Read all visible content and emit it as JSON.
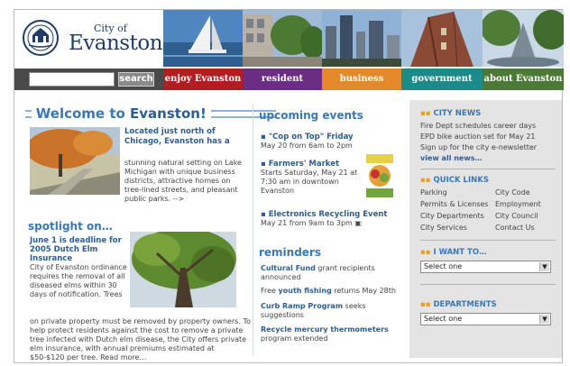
{
  "header": {
    "logo_small": "City of",
    "logo_big": "Evanston"
  },
  "search": {
    "placeholder": "",
    "button_label": "search"
  },
  "nav": [
    {
      "label": "enjoy Evanston",
      "color": "#b01e24"
    },
    {
      "label": "resident",
      "color": "#6b2d83"
    },
    {
      "label": "business",
      "color": "#e3892a"
    },
    {
      "label": "government",
      "color": "#1d8a8a"
    },
    {
      "label": "about Evanston",
      "color": "#4c7a36"
    }
  ],
  "welcome": {
    "title_prefix": "Welcome to ",
    "title_name": "Evanston!",
    "lead": "Located just north of Chicago, Evanston has a",
    "body": "stunning natural setting on Lake Michigan with unique business districts, attractive homes on tree-lined streets, and pleasant public parks. -->"
  },
  "spotlight": {
    "title": "spotlight on…",
    "headline": "June 1 is deadline for 2005 Dutch Elm Insurance",
    "body_1": "City of Evanston ordinance requires the removal of all diseased elms within 30 days of notification. Trees",
    "body_2": "on private property must be removed by property owners. To help protect residents against the cost to remove a private tree infected with Dutch elm disease, the City offers private elm insurance, with annual premiums estimated at $50-$120 per tree. Read more…"
  },
  "events": {
    "title": "upcoming events",
    "items": [
      {
        "title": "\"Cop on Top\" Friday",
        "detail": "May 20 from 6am to 2pm"
      },
      {
        "title": "Farmers' Market",
        "detail": "Starts Saturday, May 21 at 7:30 am in downtown Evanston"
      },
      {
        "title": "Electronics Recycling Event",
        "detail": "May 21 from 9am to 3pm"
      }
    ]
  },
  "reminders": {
    "title": "reminders",
    "items": [
      {
        "bold": "Cultural Fund",
        "text": " grant recipients announced",
        "pre": ""
      },
      {
        "bold": "youth fishing",
        "text": " returns May 28th",
        "pre": "Free "
      },
      {
        "bold": "Curb Ramp Program",
        "text": " seeks suggestions",
        "pre": ""
      },
      {
        "bold": "Recycle mercury thermometers",
        "text": " program extended",
        "pre": ""
      }
    ]
  },
  "sidebar": {
    "city_news": {
      "title": "CITY NEWS",
      "items": [
        "Fire Dept schedules career days",
        "EPD bike auction set for May 21",
        "Sign up for the city e-newsletter"
      ],
      "view_all": "view all news…"
    },
    "quick_links": {
      "title": "QUICK LINKS",
      "left": [
        "Parking",
        "Permits & Licenses",
        "City Departments",
        "City Services"
      ],
      "right": [
        "City Code",
        "Employment",
        "City Council",
        "Contact Us"
      ]
    },
    "i_want_to": {
      "title": "I WANT TO…",
      "selected": "Select one"
    },
    "departments": {
      "title": "DEPARTMENTS",
      "selected": "Select one"
    }
  }
}
